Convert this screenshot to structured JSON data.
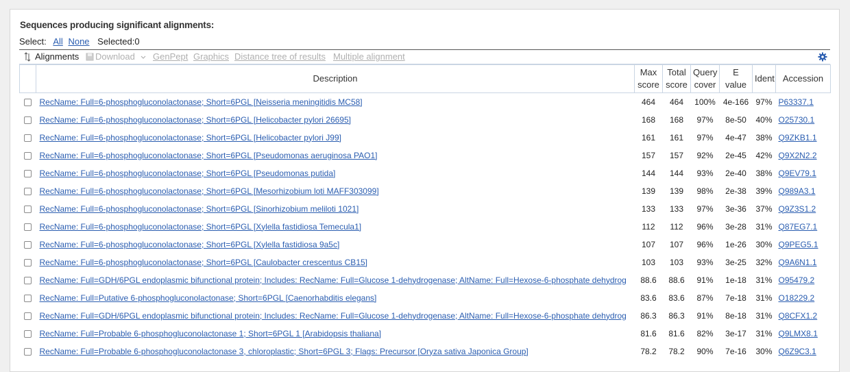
{
  "page_title": "Sequences producing significant alignments:",
  "select": {
    "label": "Select:",
    "all": "All",
    "none": "None",
    "selected": "Selected:0"
  },
  "toolbar": {
    "alignments": "Alignments",
    "download": "Download",
    "genpept": "GenPept",
    "graphics": "Graphics",
    "distance_tree": "Distance tree of results",
    "multiple_alignment": "Multiple alignment"
  },
  "columns": {
    "description": "Description",
    "max_score": [
      "Max",
      "score"
    ],
    "total_score": [
      "Total",
      "score"
    ],
    "query_cover": [
      "Query",
      "cover"
    ],
    "e_value": [
      "E",
      "value"
    ],
    "ident": "Ident",
    "accession": "Accession"
  },
  "rows": [
    {
      "desc": "RecName: Full=6-phosphogluconolactonase; Short=6PGL [Neisseria meningitidis MC58]",
      "max": "464",
      "total": "464",
      "cover": "100%",
      "e": "4e-166",
      "ident": "97%",
      "acc": "P63337.1"
    },
    {
      "desc": "RecName: Full=6-phosphogluconolactonase; Short=6PGL [Helicobacter pylori 26695]",
      "max": "168",
      "total": "168",
      "cover": "97%",
      "e": "8e-50",
      "ident": "40%",
      "acc": "O25730.1"
    },
    {
      "desc": "RecName: Full=6-phosphogluconolactonase; Short=6PGL [Helicobacter pylori J99]",
      "max": "161",
      "total": "161",
      "cover": "97%",
      "e": "4e-47",
      "ident": "38%",
      "acc": "Q9ZKB1.1"
    },
    {
      "desc": "RecName: Full=6-phosphogluconolactonase; Short=6PGL [Pseudomonas aeruginosa PAO1]",
      "max": "157",
      "total": "157",
      "cover": "92%",
      "e": "2e-45",
      "ident": "42%",
      "acc": "Q9X2N2.2"
    },
    {
      "desc": "RecName: Full=6-phosphogluconolactonase; Short=6PGL [Pseudomonas putida]",
      "max": "144",
      "total": "144",
      "cover": "93%",
      "e": "2e-40",
      "ident": "38%",
      "acc": "Q9EV79.1"
    },
    {
      "desc": "RecName: Full=6-phosphogluconolactonase; Short=6PGL [Mesorhizobium loti MAFF303099]",
      "max": "139",
      "total": "139",
      "cover": "98%",
      "e": "2e-38",
      "ident": "39%",
      "acc": "Q989A3.1"
    },
    {
      "desc": "RecName: Full=6-phosphogluconolactonase; Short=6PGL [Sinorhizobium meliloti 1021]",
      "max": "133",
      "total": "133",
      "cover": "97%",
      "e": "3e-36",
      "ident": "37%",
      "acc": "Q9Z3S1.2"
    },
    {
      "desc": "RecName: Full=6-phosphogluconolactonase; Short=6PGL [Xylella fastidiosa Temecula1]",
      "max": "112",
      "total": "112",
      "cover": "96%",
      "e": "3e-28",
      "ident": "31%",
      "acc": "Q87EG7.1"
    },
    {
      "desc": "RecName: Full=6-phosphogluconolactonase; Short=6PGL [Xylella fastidiosa 9a5c]",
      "max": "107",
      "total": "107",
      "cover": "96%",
      "e": "1e-26",
      "ident": "30%",
      "acc": "Q9PEG5.1"
    },
    {
      "desc": "RecName: Full=6-phosphogluconolactonase; Short=6PGL [Caulobacter crescentus CB15]",
      "max": "103",
      "total": "103",
      "cover": "93%",
      "e": "3e-25",
      "ident": "32%",
      "acc": "Q9A6N1.1"
    },
    {
      "desc": "RecName: Full=GDH/6PGL endoplasmic bifunctional protein; Includes: RecName: Full=Glucose 1-dehydrogenase; AltName: Full=Hexose-6-phosphate dehydrog",
      "max": "88.6",
      "total": "88.6",
      "cover": "91%",
      "e": "1e-18",
      "ident": "31%",
      "acc": "O95479.2"
    },
    {
      "desc": "RecName: Full=Putative 6-phosphogluconolactonase; Short=6PGL [Caenorhabditis elegans]",
      "max": "83.6",
      "total": "83.6",
      "cover": "87%",
      "e": "7e-18",
      "ident": "31%",
      "acc": "O18229.2"
    },
    {
      "desc": "RecName: Full=GDH/6PGL endoplasmic bifunctional protein; Includes: RecName: Full=Glucose 1-dehydrogenase; AltName: Full=Hexose-6-phosphate dehydrog",
      "max": "86.3",
      "total": "86.3",
      "cover": "91%",
      "e": "8e-18",
      "ident": "31%",
      "acc": "Q8CFX1.2"
    },
    {
      "desc": "RecName: Full=Probable 6-phosphogluconolactonase 1; Short=6PGL 1 [Arabidopsis thaliana]",
      "max": "81.6",
      "total": "81.6",
      "cover": "82%",
      "e": "3e-17",
      "ident": "31%",
      "acc": "Q9LMX8.1"
    },
    {
      "desc": "RecName: Full=Probable 6-phosphogluconolactonase 3, chloroplastic; Short=6PGL 3; Flags: Precursor [Oryza sativa Japonica Group]",
      "max": "78.2",
      "total": "78.2",
      "cover": "90%",
      "e": "7e-16",
      "ident": "30%",
      "acc": "Q6Z9C3.1"
    }
  ],
  "icons": {
    "sort": "sort-arrows-icon",
    "download": "download-icon",
    "dropdown": "chevron-down-icon",
    "settings": "gear-icon"
  },
  "colors": {
    "link": "#2a5db0",
    "disabled": "#b0b0b0",
    "border": "#c9d5e3",
    "gear": "#2a5db0"
  }
}
